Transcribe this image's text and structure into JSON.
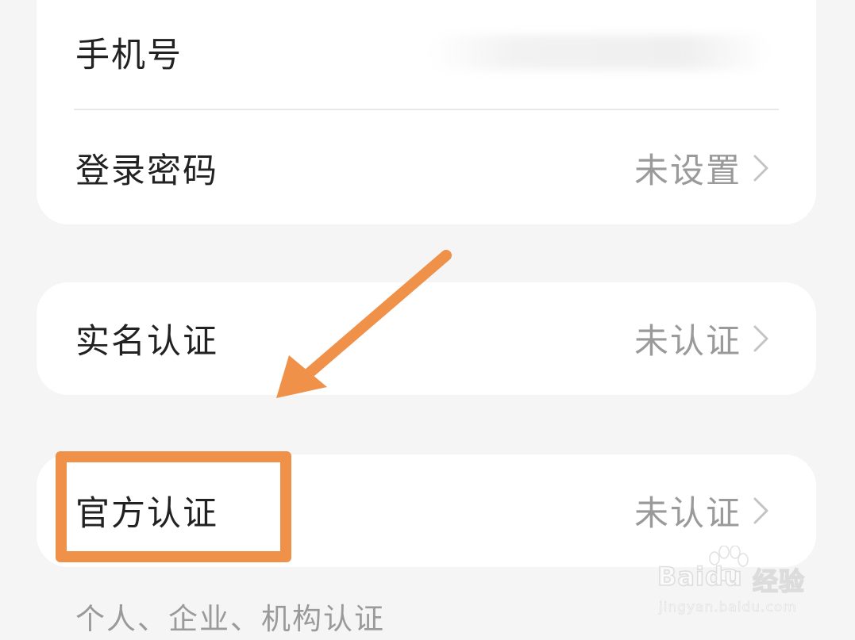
{
  "account_card": {
    "phone": {
      "label": "手机号",
      "value_masked": true
    },
    "password": {
      "label": "登录密码",
      "value": "未设置"
    }
  },
  "realname_card": {
    "label": "实名认证",
    "value": "未认证"
  },
  "official_card": {
    "label": "官方认证",
    "value": "未认证"
  },
  "hint": "个人、企业、机构认证",
  "annotation": {
    "color": "#f0914a",
    "arrow_points_to": "official-verification-row",
    "highlight_target": "官方认证"
  },
  "watermark": {
    "brand": "Bai",
    "brand_suffix": "du",
    "cn": "经验",
    "url": "jingyan.baidu.com"
  },
  "icons": {
    "chevron": "chevron-right-icon"
  },
  "colors": {
    "background": "#f5f5f5",
    "card": "#ffffff",
    "label": "#222222",
    "value": "#9a9a9a",
    "accent": "#f0914a"
  }
}
